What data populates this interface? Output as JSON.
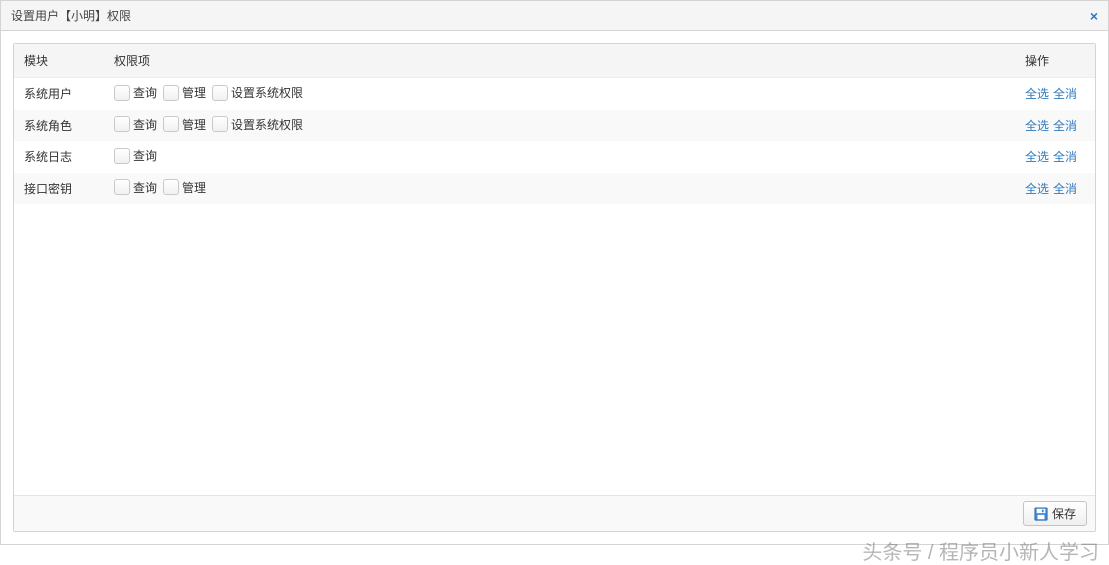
{
  "dialog": {
    "title": "设置用户【小明】权限",
    "close_symbol": "×"
  },
  "table": {
    "headers": {
      "module": "模块",
      "permissions": "权限项",
      "actions": "操作"
    },
    "action_links": {
      "select_all": "全选",
      "deselect_all": "全消"
    },
    "rows": [
      {
        "module": "系统用户",
        "permissions": [
          "查询",
          "管理",
          "设置系统权限"
        ]
      },
      {
        "module": "系统角色",
        "permissions": [
          "查询",
          "管理",
          "设置系统权限"
        ]
      },
      {
        "module": "系统日志",
        "permissions": [
          "查询"
        ]
      },
      {
        "module": "接口密钥",
        "permissions": [
          "查询",
          "管理"
        ]
      }
    ]
  },
  "footer": {
    "save_label": "保存"
  },
  "watermark": "头条号 / 程序员小新人学习"
}
